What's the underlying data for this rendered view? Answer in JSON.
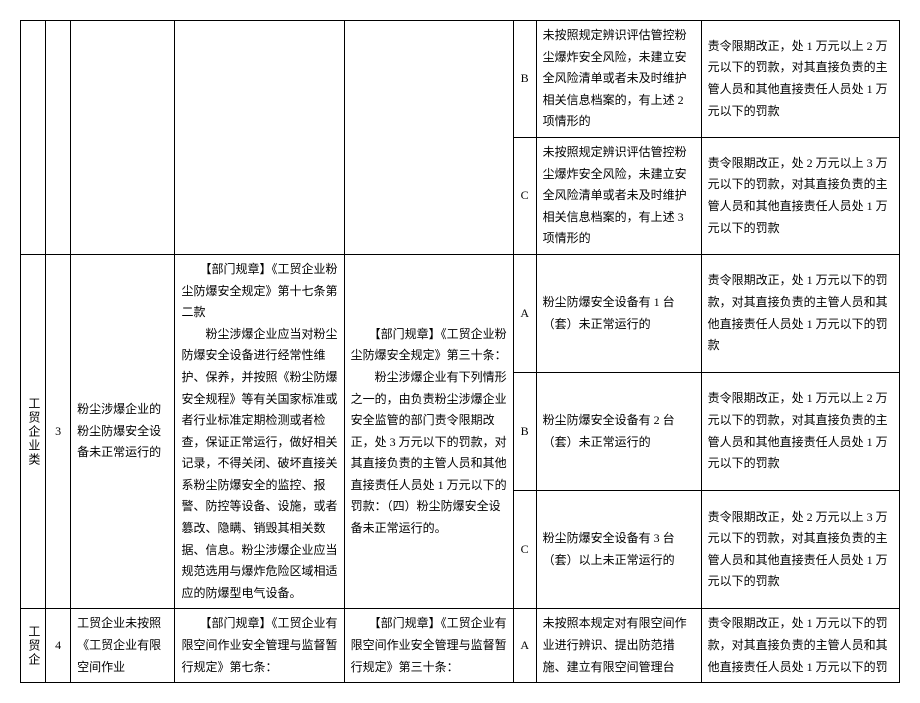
{
  "row1": {
    "level": "B",
    "condition": "未按照规定辨识评估管控粉尘爆炸安全风险，未建立安全风险清单或者未及时维护相关信息档案的，有上述 2 项情形的",
    "penalty": "责令限期改正，处 1 万元以上 2 万元以下的罚款，对其直接负责的主管人员和其他直接责任人员处 1 万元以下的罚款"
  },
  "row2": {
    "level": "C",
    "condition": "未按照规定辨识评估管控粉尘爆炸安全风险，未建立安全风险清单或者未及时维护相关信息档案的，有上述 3 项情形的",
    "penalty": "责令限期改正，处 2 万元以上 3 万元以下的罚款，对其直接负责的主管人员和其他直接责任人员处 1 万元以下的罚款"
  },
  "section2": {
    "category": "工贸企业类",
    "num": "3",
    "violation": "粉尘涉爆企业的粉尘防爆安全设备未正常运行的",
    "basis1": "　　【部门规章】《工贸企业粉尘防爆安全规定》第十七条第二款\n　　粉尘涉爆企业应当对粉尘防爆安全设备进行经常性维护、保养，并按照《粉尘防爆安全规程》等有关国家标准或者行业标准定期检测或者检查，保证正常运行，做好相关记录，不得关闭、破坏直接关系粉尘防爆安全的监控、报警、防控等设备、设施，或者篡改、隐瞒、销毁其相关数据、信息。粉尘涉爆企业应当规范选用与爆炸危险区域相适应的防爆型电气设备。",
    "basis2": "　　【部门规章】《工贸企业粉尘防爆安全规定》第三十条：\n　　粉尘涉爆企业有下列情形之一的，由负责粉尘涉爆企业安全监管的部门责令限期改正，处 3 万元以下的罚款，对其直接负责的主管人员和其他直接责任人员处 1 万元以下的罚款：（四）粉尘防爆安全设备未正常运行的。"
  },
  "row3": {
    "level": "A",
    "condition": "粉尘防爆安全设备有 1 台（套）未正常运行的",
    "penalty": "责令限期改正，处 1 万元以下的罚款，对其直接负责的主管人员和其他直接责任人员处 1 万元以下的罚款"
  },
  "row4": {
    "level": "B",
    "condition": "粉尘防爆安全设备有 2 台（套）未正常运行的",
    "penalty": "责令限期改正，处 1 万元以上 2 万元以下的罚款，对其直接负责的主管人员和其他直接责任人员处 1 万元以下的罚款"
  },
  "row5": {
    "level": "C",
    "condition": "粉尘防爆安全设备有 3 台（套）以上未正常运行的",
    "penalty": "责令限期改正，处 2 万元以上 3 万元以下的罚款，对其直接负责的主管人员和其他直接责任人员处 1 万元以下的罚款"
  },
  "section3": {
    "category": "工贸企",
    "num": "4",
    "violation": "工贸企业未按照《工贸企业有限空间作业",
    "basis1": "　　【部门规章】《工贸企业有限空间作业安全管理与监督暂行规定》第七条：",
    "basis2": "　　【部门规章】《工贸企业有限空间作业安全管理与监督暂行规定》第三十条："
  },
  "row6": {
    "level": "A",
    "condition": "未按照本规定对有限空间作业进行辨识、提出防范措施、建立有限空间管理台",
    "penalty": "责令限期改正，处 1 万元以下的罚款，对其直接负责的主管人员和其他直接责任人员处 1 万元以下的罚"
  }
}
